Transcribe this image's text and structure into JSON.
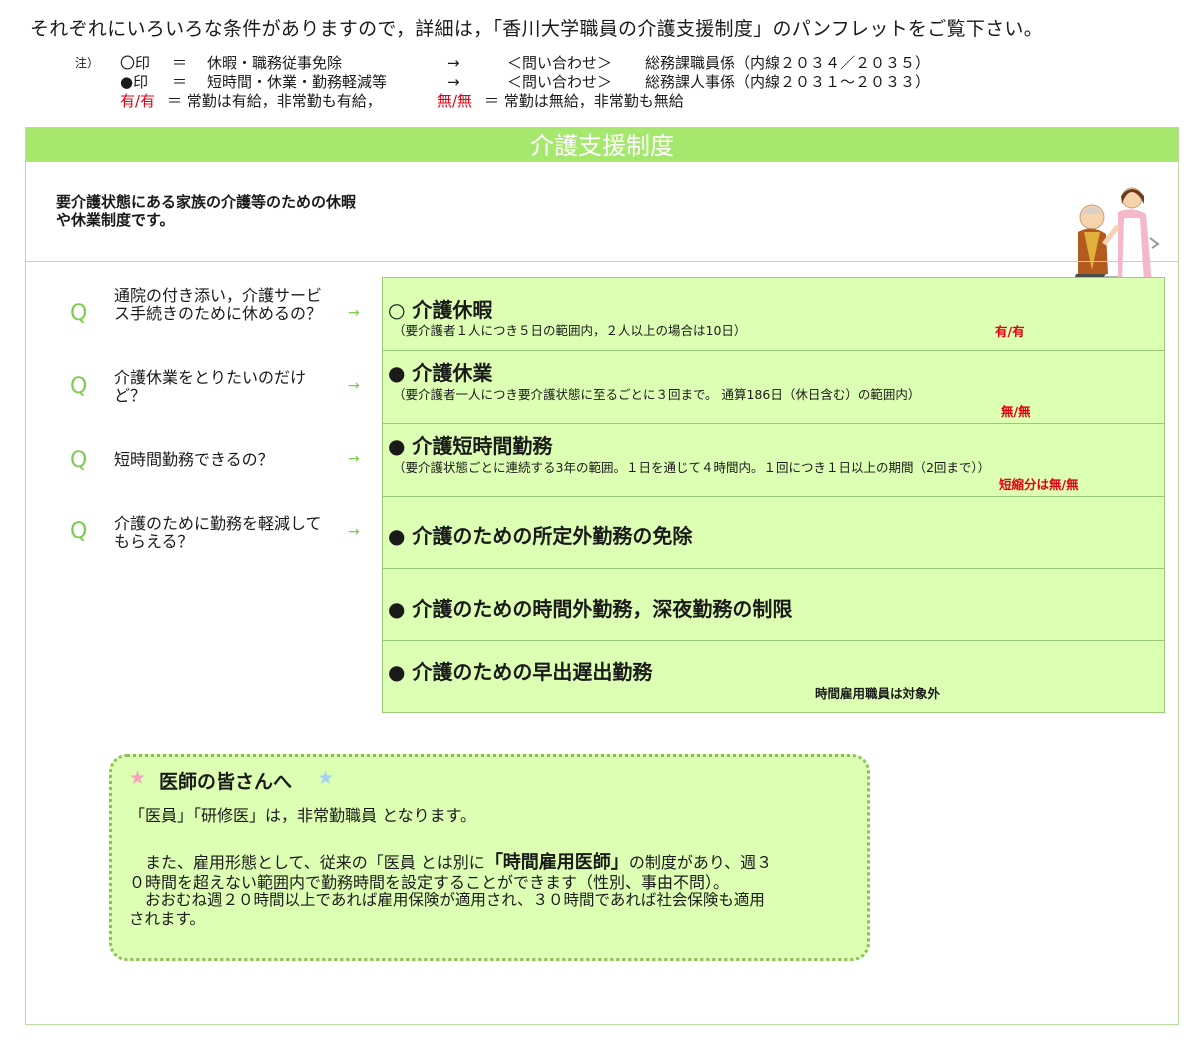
{
  "intro": "それぞれにいろいろな条件がありますので，詳細は，「香川大学職員の介護支援制度」のパンフレットをご覧下さい。",
  "notes": {
    "prefix": "注）",
    "row1": {
      "mark": "〇印",
      "eq": "＝",
      "desc": "休暇・職務従事免除",
      "arrow": "→",
      "contact_label": "＜問い合わせ＞",
      "contact": "総務課職員係（内線２０３４／２０３５）"
    },
    "row2": {
      "mark": "●印",
      "eq": "＝",
      "desc": "短時間・休業・勤務軽減等",
      "arrow": "→",
      "contact_label": "＜問い合わせ＞",
      "contact": "総務課人事係（内線２０３１～２０３３）"
    },
    "row3": {
      "paid_label": "有/有",
      "paid_text": "＝ 常勤は有給，非常勤も有給，",
      "unpaid_label": "無/無",
      "unpaid_text": "＝ 常勤は無給，非常勤も無給"
    }
  },
  "panel": {
    "title": "介護支援制度",
    "description": "要介護状態にある家族の介護等のための休暇や休業制度です。"
  },
  "questions": [
    {
      "q": "Q",
      "text": "通院の付き添い，介護サービス手続きのために休めるの？",
      "arrow": "→"
    },
    {
      "q": "Q",
      "text": "介護休業をとりたいのだけど？",
      "arrow": "→"
    },
    {
      "q": "Q",
      "text": "短時間勤務できるの？",
      "arrow": "→"
    },
    {
      "q": "Q",
      "text": "介護のために勤務を軽減してもらえる？",
      "arrow": "→"
    }
  ],
  "items": [
    {
      "title": "○ 介護休暇",
      "sub": "（要介護者１人につき５日の範囲内，２人以上の場合は10日）",
      "pay": "有/有"
    },
    {
      "title": "● 介護休業",
      "sub": "（要介護者一人につき要介護状態に至るごとに３回まで。 通算186日（休日含む）の範囲内）",
      "pay": "無/無"
    },
    {
      "title": "● 介護短時間勤務",
      "sub": "（要介護状態ごとに連続する3年の範囲。１日を通じて４時間内。１回につき１日以上の期間（2回まで））",
      "pay": "短縮分は無/無"
    },
    {
      "title": "● 介護のための所定外勤務の免除"
    },
    {
      "title": "● 介護のための時間外勤務，深夜勤務の制限"
    },
    {
      "title": "● 介護のための早出遅出勤務",
      "note": "時間雇用職員は対象外"
    }
  ],
  "doctor_box": {
    "star_left": "★",
    "heading": "医師の皆さんへ",
    "star_right": "★",
    "line1": "「医員」「研修医」は，非常勤職員 となります。",
    "p2_a": "また、雇用形態として、従来の「医員 とは別に",
    "p2_b": "「時間雇用医師」",
    "p2_c": "の制度があり、週３",
    "p2_d": "０時間を超えない範囲内で勤務時間を設定することができます（性別、事由不問）。",
    "p3_a": "おおむね週２０時間以上であれば雇用保険が適用され、３０時間であれば社会保険も適用",
    "p3_b": "されます。"
  },
  "colors": {
    "accent": "#a6e86e",
    "box": "#dcffb4",
    "q": "#7ecb4d",
    "red": "#e60012",
    "star_pink": "#f4a6b8",
    "star_blue": "#a8d0f0"
  },
  "icon": "caregiver-wheelchair-illustration"
}
